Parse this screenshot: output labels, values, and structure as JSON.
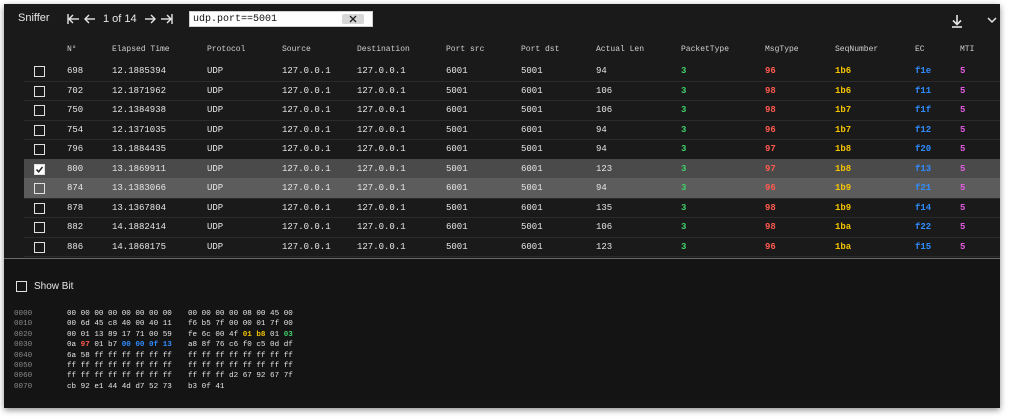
{
  "toolbar": {
    "title": "Sniffer",
    "pager_text": "1 of 14",
    "filter_value": "udp.port==5001"
  },
  "colors": {
    "packet_type": "#3fcf6a",
    "msg_type": "#ff5a4f",
    "seq_number": "#f2c200",
    "ec": "#2f8cff",
    "mti": "#e05ae0",
    "selected_row": "#4a4a4a",
    "hover_row": "#5c5c5c"
  },
  "columns": [
    "N°",
    "Elapsed Time",
    "Protocol",
    "Source",
    "Destination",
    "Port src",
    "Port dst",
    "Actual Len",
    "PacketType",
    "MsgType",
    "SeqNumber",
    "EC",
    "MTI"
  ],
  "rows": [
    {
      "n": "698",
      "time": "12.1885394",
      "proto": "UDP",
      "src": "127.0.0.1",
      "dst": "127.0.0.1",
      "psrc": "6001",
      "pdst": "5001",
      "len": "94",
      "ptype": "3",
      "mtype": "96",
      "seq": "1b6",
      "ec": "f1e",
      "mti": "5",
      "checked": false,
      "state": ""
    },
    {
      "n": "702",
      "time": "12.1871962",
      "proto": "UDP",
      "src": "127.0.0.1",
      "dst": "127.0.0.1",
      "psrc": "5001",
      "pdst": "6001",
      "len": "106",
      "ptype": "3",
      "mtype": "98",
      "seq": "1b6",
      "ec": "f11",
      "mti": "5",
      "checked": false,
      "state": ""
    },
    {
      "n": "750",
      "time": "12.1384938",
      "proto": "UDP",
      "src": "127.0.0.1",
      "dst": "127.0.0.1",
      "psrc": "6001",
      "pdst": "5001",
      "len": "106",
      "ptype": "3",
      "mtype": "98",
      "seq": "1b7",
      "ec": "f1f",
      "mti": "5",
      "checked": false,
      "state": ""
    },
    {
      "n": "754",
      "time": "12.1371035",
      "proto": "UDP",
      "src": "127.0.0.1",
      "dst": "127.0.0.1",
      "psrc": "5001",
      "pdst": "6001",
      "len": "94",
      "ptype": "3",
      "mtype": "96",
      "seq": "1b7",
      "ec": "f12",
      "mti": "5",
      "checked": false,
      "state": ""
    },
    {
      "n": "796",
      "time": "13.1884435",
      "proto": "UDP",
      "src": "127.0.0.1",
      "dst": "127.0.0.1",
      "psrc": "6001",
      "pdst": "5001",
      "len": "94",
      "ptype": "3",
      "mtype": "97",
      "seq": "1b8",
      "ec": "f20",
      "mti": "5",
      "checked": false,
      "state": ""
    },
    {
      "n": "800",
      "time": "13.1869911",
      "proto": "UDP",
      "src": "127.0.0.1",
      "dst": "127.0.0.1",
      "psrc": "5001",
      "pdst": "6001",
      "len": "123",
      "ptype": "3",
      "mtype": "97",
      "seq": "1b8",
      "ec": "f13",
      "mti": "5",
      "checked": true,
      "state": "sel"
    },
    {
      "n": "874",
      "time": "13.1383066",
      "proto": "UDP",
      "src": "127.0.0.1",
      "dst": "127.0.0.1",
      "psrc": "6001",
      "pdst": "5001",
      "len": "94",
      "ptype": "3",
      "mtype": "96",
      "seq": "1b9",
      "ec": "f21",
      "mti": "5",
      "checked": false,
      "state": "hov"
    },
    {
      "n": "878",
      "time": "13.1367804",
      "proto": "UDP",
      "src": "127.0.0.1",
      "dst": "127.0.0.1",
      "psrc": "5001",
      "pdst": "6001",
      "len": "135",
      "ptype": "3",
      "mtype": "98",
      "seq": "1b9",
      "ec": "f14",
      "mti": "5",
      "checked": false,
      "state": ""
    },
    {
      "n": "882",
      "time": "14.1882414",
      "proto": "UDP",
      "src": "127.0.0.1",
      "dst": "127.0.0.1",
      "psrc": "6001",
      "pdst": "5001",
      "len": "106",
      "ptype": "3",
      "mtype": "98",
      "seq": "1ba",
      "ec": "f22",
      "mti": "5",
      "checked": false,
      "state": ""
    },
    {
      "n": "886",
      "time": "14.1868175",
      "proto": "UDP",
      "src": "127.0.0.1",
      "dst": "127.0.0.1",
      "psrc": "5001",
      "pdst": "6001",
      "len": "123",
      "ptype": "3",
      "mtype": "96",
      "seq": "1ba",
      "ec": "f15",
      "mti": "5",
      "checked": false,
      "state": ""
    }
  ],
  "show_bit_label": "Show Bit",
  "hex_dump": [
    {
      "offset": "0000",
      "left": "00 00 00 00 00 00 00 00",
      "right": "00 00 00 00 08 00 45 00"
    },
    {
      "offset": "0010",
      "left": "00 6d 45 c8 40 00 40 11",
      "right": "f6 b5 7f 00 00 01 7f 00"
    },
    {
      "offset": "0020",
      "left": "00 01 13 89 17 71 00 59",
      "right": "fe 6c 00 4f 01 b8 01 03"
    },
    {
      "offset": "0030",
      "left": "0a 97 01 b7 00 00 0f 13",
      "right": "a8 8f 76 c6 f0 c5 0d df"
    },
    {
      "offset": "0040",
      "left": "6a 58 ff ff ff ff ff ff",
      "right": "ff ff ff ff ff ff ff ff"
    },
    {
      "offset": "0050",
      "left": "ff ff ff ff ff ff ff ff",
      "right": "ff ff ff ff ff ff ff ff"
    },
    {
      "offset": "0060",
      "left": "ff ff ff ff ff ff ff ff",
      "right": "ff ff ff d2 67 92 67 7f"
    },
    {
      "offset": "0070",
      "left": "cb 92 e1 44 4d d7 52 73",
      "right": "b3 0f 41"
    }
  ]
}
